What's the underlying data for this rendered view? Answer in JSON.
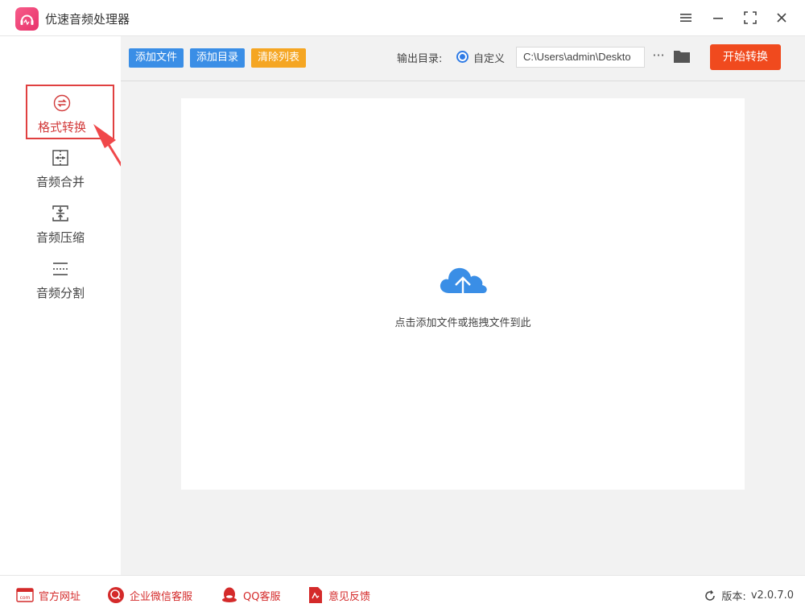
{
  "app": {
    "title": "优速音频处理器"
  },
  "window_controls": [
    "menu-icon",
    "minimize-icon",
    "maximize-icon",
    "close-icon"
  ],
  "toolbar": {
    "add_file": "添加文件",
    "add_dir": "添加目录",
    "clear_list": "清除列表",
    "output_label": "输出目录:",
    "radio_label": "自定义",
    "path_value": "C:\\Users\\admin\\Deskto",
    "more": "···",
    "start": "开始转换"
  },
  "sidebar": {
    "items": [
      {
        "label": "格式转换",
        "icon": "convert-icon",
        "active": true
      },
      {
        "label": "音频合并",
        "icon": "merge-icon",
        "active": false
      },
      {
        "label": "音频压缩",
        "icon": "compress-icon",
        "active": false
      },
      {
        "label": "音频分割",
        "icon": "split-icon",
        "active": false
      }
    ]
  },
  "dropzone": {
    "text": "点击添加文件或拖拽文件到此",
    "icon": "cloud-upload-icon"
  },
  "footer": {
    "links": [
      {
        "label": "官方网址",
        "icon": "website-icon"
      },
      {
        "label": "企业微信客服",
        "icon": "wechat-service-icon"
      },
      {
        "label": "QQ客服",
        "icon": "qq-icon"
      },
      {
        "label": "意见反馈",
        "icon": "feedback-icon"
      }
    ],
    "version_label": "版本:",
    "version_number": "v2.0.7.0"
  },
  "colors": {
    "primary": "#3a8ee6",
    "orange": "#f5a623",
    "start": "#f04a1e",
    "accent_red": "#d42a2a"
  }
}
